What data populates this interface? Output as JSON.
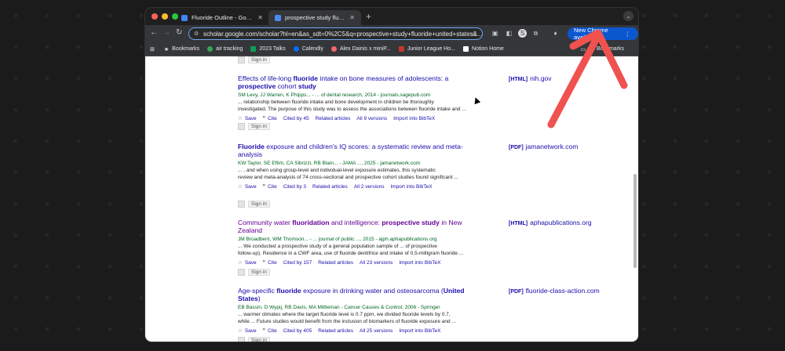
{
  "tabs": [
    {
      "label": "Fluoride Outline - Google Doc",
      "icon": "google-docs-icon"
    },
    {
      "label": "prospective study fluoride u",
      "icon": "scholar-icon"
    }
  ],
  "address": {
    "url": "scholar.google.com/scholar?hl=en&as_sdt=0%2C5&q=prospective+study+fluoride+united+states&..."
  },
  "new_chrome": "New Chrome available",
  "bookmarks": [
    {
      "label": "Bookmarks",
      "icon": "star-icon",
      "color": "#e8eaed"
    },
    {
      "label": "air tracking",
      "icon": "globe-icon",
      "color": "#34a853"
    },
    {
      "label": "2023 Talks",
      "icon": "sheets-icon",
      "color": "#0f9d58"
    },
    {
      "label": "Calendly",
      "icon": "calendly-icon",
      "color": "#006bff"
    },
    {
      "label": "Alex Dainis x miniP...",
      "icon": "asana-icon",
      "color": "#f06a6a"
    },
    {
      "label": "Junior League Ho...",
      "icon": "jl-icon",
      "color": "#c0392b"
    },
    {
      "label": "Notion Home",
      "icon": "notion-icon",
      "color": "#ffffff"
    }
  ],
  "all_bookmarks": "All Bookmarks",
  "signin_label": "Sign in",
  "actions": {
    "save": "Save",
    "cite": "Cite",
    "related": "Related articles",
    "bibtex": "Import into BibTeX"
  },
  "results": [
    {
      "title_pre": "Effects of life-long ",
      "title_b1": "fluoride",
      "title_mid": " intake on bone measures of adolescents: a ",
      "title_b2": "prospective",
      "title_post": " cohort ",
      "title_b3": "study",
      "authors": "SM Levy, JJ Warren, K Phipps... - ... of dental research, 2014 - journals.sagepub.com",
      "snippet1": "... relationship between fluoride intake and bone development in children be thoroughly",
      "snippet2": "investigated. The purpose of this study was to assess the associations between fluoride intake and ...",
      "cited": "Cited by 45",
      "versions": "All 9 versions",
      "side_tag": "[HTML]",
      "side_src": "nih.gov"
    },
    {
      "title_pre": "",
      "title_b1": "Fluoride",
      "title_mid": " exposure and children's IQ scores: a systematic review and meta-analysis",
      "title_b2": "",
      "title_post": "",
      "title_b3": "",
      "authors": "KW Taylor, SE Eftim, CA Sibrizzi, RB Blain... - JAMA ..., 2025 - jamanetwork.com",
      "snippet1": "... , and when using group-level and individual-level exposure estimates, this systematic",
      "snippet2": "review and meta-analysis of 74 cross-sectional and prospective cohort studies found significant ...",
      "cited": "Cited by 3",
      "versions": "All 2 versions",
      "side_tag": "[PDF]",
      "side_src": "jamanetwork.com"
    },
    {
      "title_pre": "Community water ",
      "title_b1": "fluoridation",
      "title_mid": " and intelligence: ",
      "title_b2": "prospective study",
      "title_post": " in New Zealand",
      "title_b3": "",
      "authors": "JM Broadbent, WM Thomson... - ... journal of public ..., 2015 - ajph.aphapublications.org",
      "snippet1": "... We conducted a prospective study of a general population sample of ... of prospective",
      "snippet2": "follow-up). Residence in a CWF area, use of fluoride dentifrice and intake of 0.5-milligram fluoride ...",
      "cited": "Cited by 157",
      "versions": "All 23 versions",
      "side_tag": "[HTML]",
      "side_src": "aphapublications.org"
    },
    {
      "title_pre": "Age-specific ",
      "title_b1": "fluoride",
      "title_mid": " exposure in drinking water and osteosarcoma (",
      "title_b2": "United States",
      "title_post": ")",
      "title_b3": "",
      "authors": "EB Bassin, D Wypij, RB Davis, MA Mittleman - Cancer Causes & Control, 2006 - Springer",
      "snippet1": "... warmer climates where the target fluoride level is 0.7 ppm, we divided fluoride levels by 0.7,",
      "snippet2": "while ... Future studies would benefit from the inclusion of biomarkers of fluoride exposure and ...",
      "cited": "Cited by 405",
      "versions": "All 25 versions",
      "side_tag": "[PDF]",
      "side_src": "fluoride-class-action.com"
    }
  ]
}
